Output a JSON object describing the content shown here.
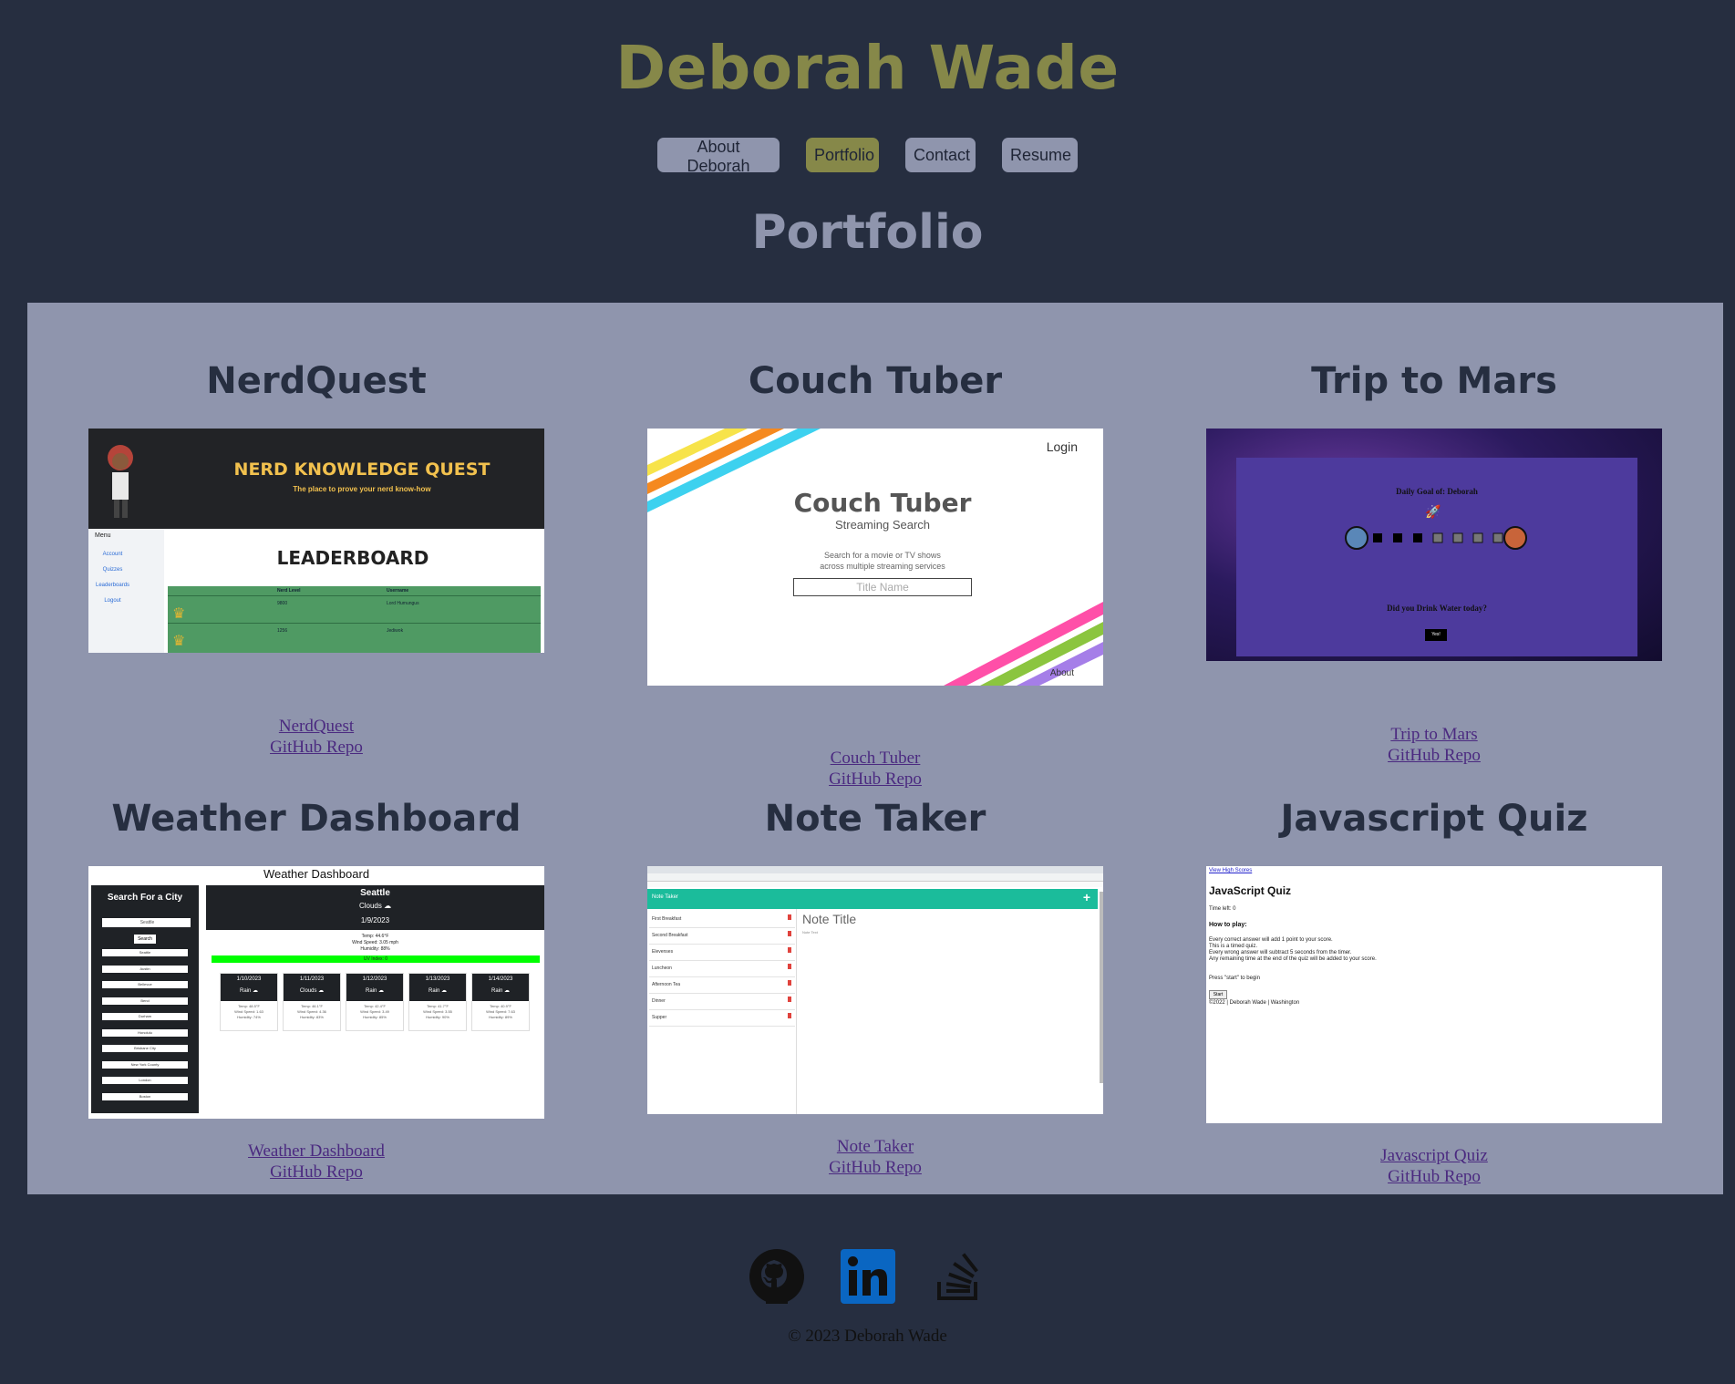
{
  "header": {
    "name": "Deborah Wade"
  },
  "nav": {
    "items": [
      "About Deborah",
      "Portfolio",
      "Contact",
      "Resume"
    ],
    "active": "Portfolio"
  },
  "section": {
    "title": "Portfolio"
  },
  "projects": [
    {
      "title": "NerdQuest",
      "link": "NerdQuest",
      "repo": "GitHub Repo",
      "shot": {
        "banner": "NERD KNOWLEDGE QUEST",
        "tagline": "The place to prove your nerd know-how",
        "menu": "Menu",
        "menu_items": [
          "Account",
          "Quizzes",
          "Leaderboards",
          "Logout"
        ],
        "board": "LEADERBOARD",
        "cols": [
          "Nerd Level",
          "Username"
        ],
        "rows": [
          [
            "9800",
            "Lord Humungus"
          ],
          [
            "1256",
            "Jediwok"
          ]
        ]
      }
    },
    {
      "title": "Couch Tuber",
      "link": "Couch Tuber",
      "repo": "GitHub Repo",
      "shot": {
        "login": "Login",
        "logo": "Couch Tuber",
        "sub": "Streaming Search",
        "desc1": "Search for a movie or TV shows",
        "desc2": "across multiple streaming services",
        "placeholder": "Title Name",
        "about": "About"
      }
    },
    {
      "title": "Trip to Mars",
      "link": "Trip to Mars",
      "repo": "GitHub Repo",
      "shot": {
        "goal": "Daily Goal of: Deborah",
        "question": "Did you Drink Water today?",
        "btn": "Yes!"
      }
    },
    {
      "title": "Weather Dashboard",
      "link": "Weather Dashboard",
      "repo": "GitHub Repo",
      "shot": {
        "header": "Weather Dashboard",
        "search_title": "Search For a City",
        "search_val": "Seattle",
        "search_btn": "Search",
        "cities": [
          "Seattle",
          "Austin",
          "Bellevue",
          "Bend",
          "Durham",
          "Honolulu",
          "Brisbane City",
          "New York County",
          "London",
          "Boston"
        ],
        "city": "Seattle",
        "cond": "Clouds ☁",
        "date": "1/9/2023",
        "temp": "Temp: 44.6°F",
        "wind": "Wind Speed: 3.05 mph",
        "humidity": "Humidity: 88%",
        "uv": "UV Index: 0",
        "forecast": [
          {
            "date": "1/10/2023",
            "cond": "Rain ☁",
            "t": "Temp: 48.5°F",
            "w": "Wind Speed: 1.63",
            "h": "Humidity: 74%"
          },
          {
            "date": "1/11/2023",
            "cond": "Clouds ☁",
            "t": "Temp: 46.1°F",
            "w": "Wind Speed: 4.36",
            "h": "Humidity: 83%"
          },
          {
            "date": "1/12/2023",
            "cond": "Rain ☁",
            "t": "Temp: 42.4°F",
            "w": "Wind Speed: 3.49",
            "h": "Humidity: 85%"
          },
          {
            "date": "1/13/2023",
            "cond": "Rain ☁",
            "t": "Temp: 41.7°F",
            "w": "Wind Speed: 3.55",
            "h": "Humidity: 90%"
          },
          {
            "date": "1/14/2023",
            "cond": "Rain ☁",
            "t": "Temp: 40.9°F",
            "w": "Wind Speed: 7.63",
            "h": "Humidity: 89%"
          }
        ]
      }
    },
    {
      "title": "Note Taker",
      "link": "Note Taker",
      "repo": "GitHub Repo",
      "shot": {
        "bar": "Note Taker",
        "plus": "+",
        "note_title": "Note Title",
        "note_text": "Note Text",
        "notes": [
          "First Breakfast",
          "Second Breakfast",
          "Elevenses",
          "Luncheon",
          "Afternoon Tea",
          "Dinner",
          "Supper"
        ]
      }
    },
    {
      "title": "Javascript Quiz",
      "link": "Javascript Quiz",
      "repo": "GitHub Repo",
      "shot": {
        "hs": "View High Scores",
        "title": "JavaScript Quiz",
        "time": "Time left: 0",
        "howto": "How to play:",
        "rules": [
          "Every correct answer will add 1 point to your score.",
          "This is a timed quiz.",
          "Every wrong answer will subtract 5 seconds from the timer.",
          "Any remaining time at the end of the quiz will be added to your score."
        ],
        "press": "Press \"start\" to begin",
        "start": "Start",
        "foot": "©2022 | Deborah Wade | Washington"
      }
    }
  ],
  "footer": {
    "icons": [
      "github-icon",
      "linkedin-icon",
      "stackoverflow-icon"
    ],
    "copyright": "© 2023 Deborah Wade"
  },
  "colors": {
    "bg": "#262e40",
    "accent": "#868849",
    "panel": "#8f95ad",
    "link": "#4b2a80"
  }
}
